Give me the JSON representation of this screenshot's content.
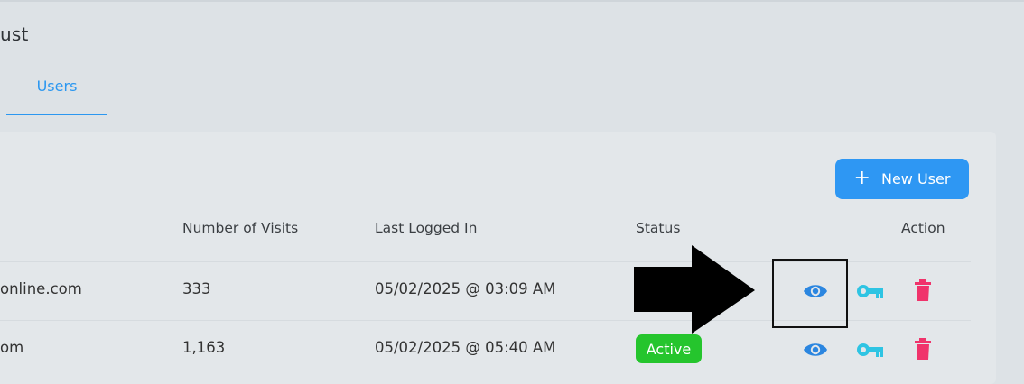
{
  "page": {
    "title": "ust"
  },
  "tabs": [
    {
      "label": "Users",
      "active": true
    }
  ],
  "toolbar": {
    "new_user_label": "New User",
    "new_user_icon": "plus-icon"
  },
  "table": {
    "columns": [
      "Number of Visits",
      "Last Logged In",
      "Status",
      "Action"
    ],
    "rows": [
      {
        "email": "online.com",
        "visits": "333",
        "last_login": "05/02/2025 @ 03:09 AM",
        "status": ""
      },
      {
        "email": "om",
        "visits": "1,163",
        "last_login": "05/02/2025 @ 05:40 AM",
        "status": "Active"
      }
    ],
    "actions": [
      "eye-icon",
      "key-icon",
      "trash-icon"
    ]
  },
  "colors": {
    "accent": "#2e97f3",
    "active_badge": "#25c52d",
    "view_icon": "#2b86e0",
    "key_icon": "#2ec4e3",
    "delete_icon": "#f0336b"
  }
}
